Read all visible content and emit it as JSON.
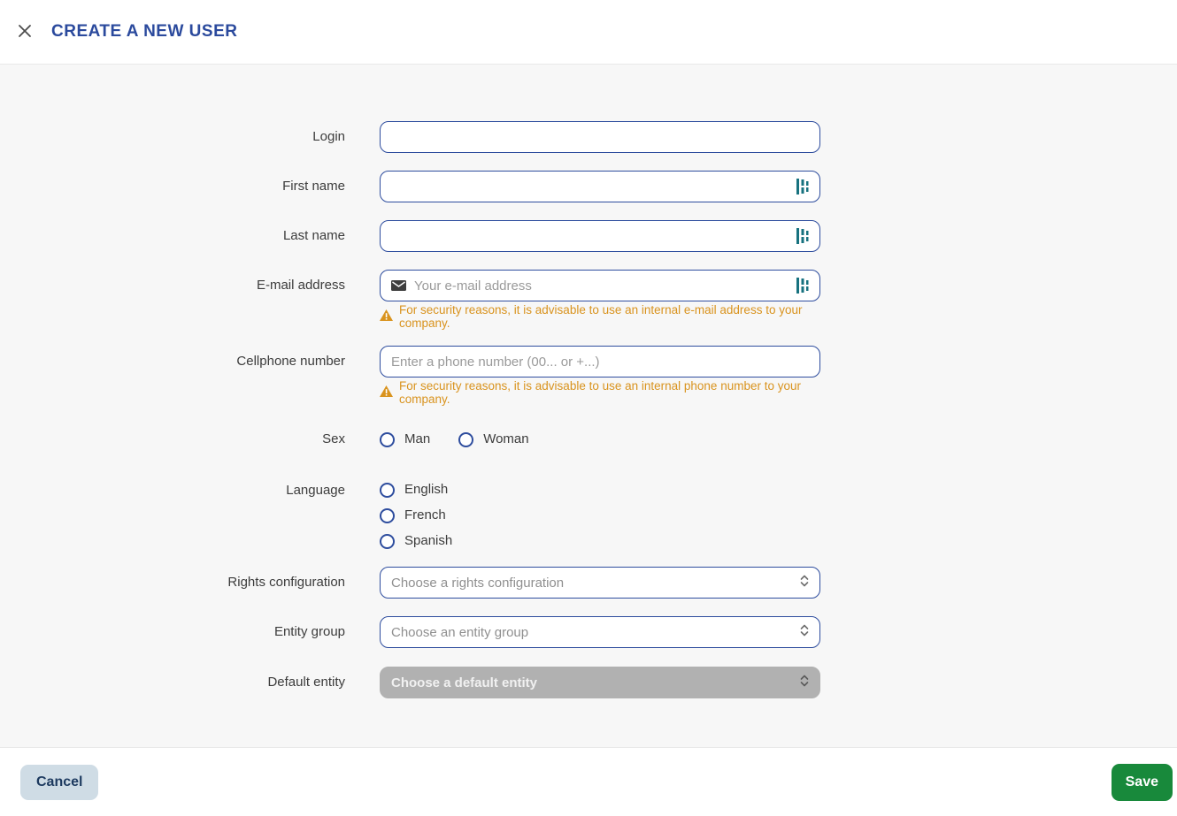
{
  "header": {
    "title": "CREATE A NEW USER"
  },
  "icons": {
    "close": "x-cross",
    "email": "envelope",
    "warning": "warning-triangle",
    "select": "up-down-chevrons",
    "field_helper": "teal-bars"
  },
  "colors": {
    "title_blue": "#2b4a9d",
    "input_border_blue": "#2e4d9e",
    "warning_orange": "#d9931e",
    "teal_icon": "#17727f",
    "save_green": "#18893b",
    "cancel_bg": "#cfdce5",
    "cancel_text": "#1d3a5f",
    "disabled_gray": "#b1b1b1",
    "content_bg": "#f7f7f7"
  },
  "form": {
    "login": {
      "label": "Login",
      "value": ""
    },
    "first_name": {
      "label": "First name",
      "value": ""
    },
    "last_name": {
      "label": "Last name",
      "value": ""
    },
    "email": {
      "label": "E-mail address",
      "placeholder": "Your e-mail address",
      "value": "",
      "warning": "For security reasons, it is advisable to use an internal e-mail address to your company."
    },
    "cellphone": {
      "label": "Cellphone number",
      "placeholder": "Enter a phone number (00... or +...)",
      "value": "",
      "warning": "For security reasons, it is advisable to use an internal phone number to your company."
    },
    "sex": {
      "label": "Sex",
      "options": [
        "Man",
        "Woman"
      ],
      "selected": null
    },
    "language": {
      "label": "Language",
      "options": [
        "English",
        "French",
        "Spanish"
      ],
      "selected": null
    },
    "rights_configuration": {
      "label": "Rights configuration",
      "placeholder": "Choose a rights configuration"
    },
    "entity_group": {
      "label": "Entity group",
      "placeholder": "Choose an entity group"
    },
    "default_entity": {
      "label": "Default entity",
      "placeholder": "Choose a default entity",
      "disabled": true
    }
  },
  "footer": {
    "cancel_label": "Cancel",
    "save_label": "Save"
  }
}
